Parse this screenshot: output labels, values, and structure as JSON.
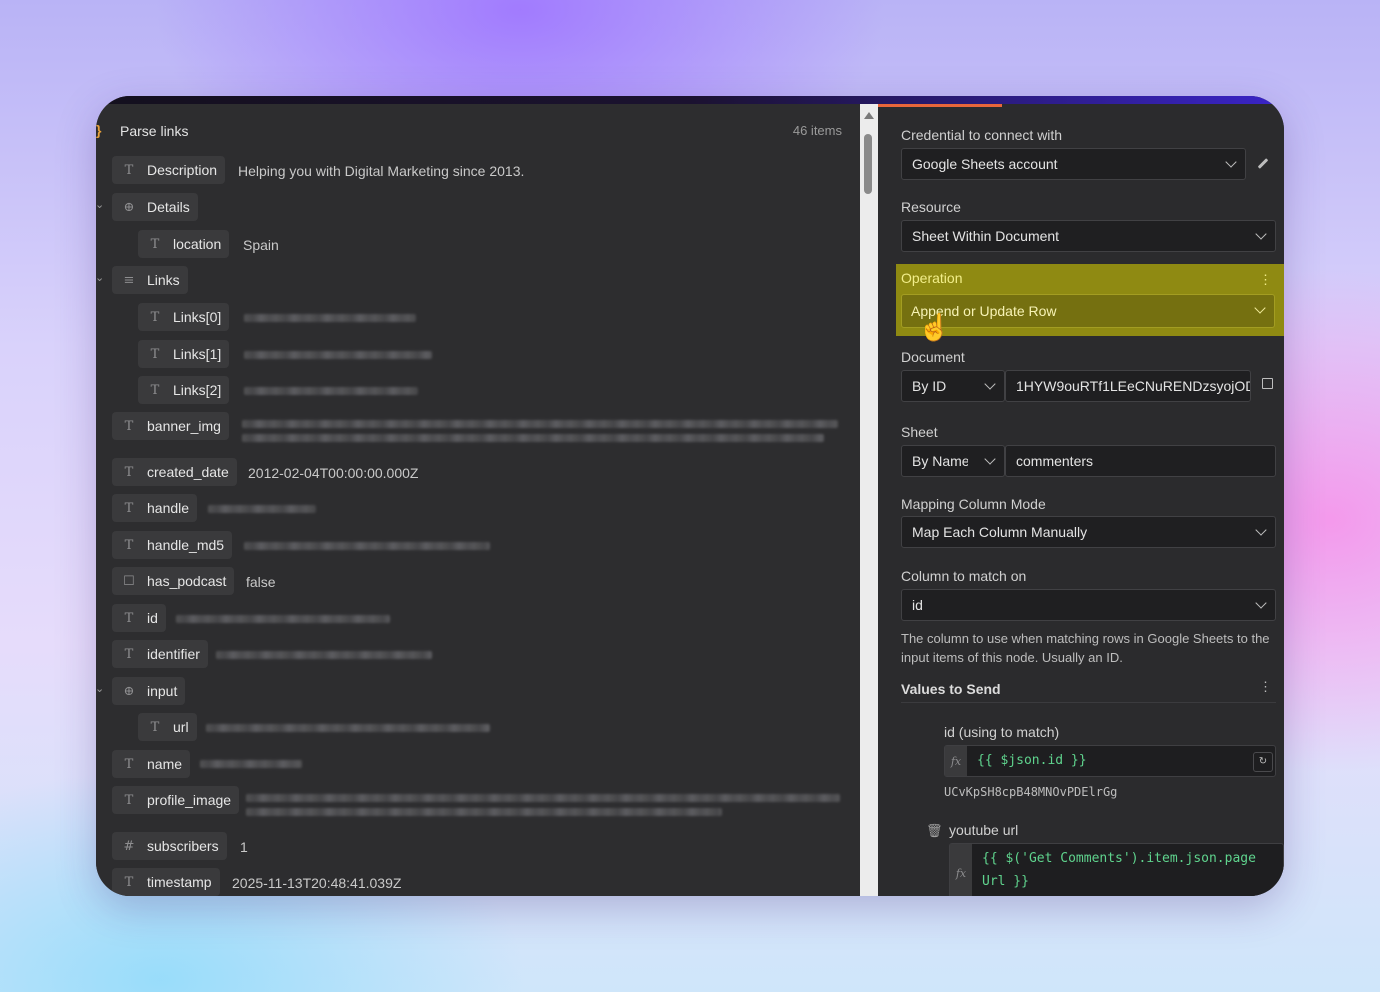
{
  "left_panel": {
    "title": "Parse links",
    "item_count": "46 items",
    "rows": [
      {
        "label": "Description",
        "type": "T",
        "value": "Helping you with Digital Marketing since 2013."
      },
      {
        "label": "Details",
        "type": "⊕",
        "value": ""
      },
      {
        "label": "location",
        "type": "T",
        "value": "Spain"
      },
      {
        "label": "Links",
        "type": "≡",
        "value": ""
      },
      {
        "label": "Links[0]",
        "type": "T",
        "value": ""
      },
      {
        "label": "Links[1]",
        "type": "T",
        "value": ""
      },
      {
        "label": "Links[2]",
        "type": "T",
        "value": ""
      },
      {
        "label": "banner_img",
        "type": "T",
        "value": ""
      },
      {
        "label": "created_date",
        "type": "T",
        "value": "2012-02-04T00:00:00.000Z"
      },
      {
        "label": "handle",
        "type": "T",
        "value": ""
      },
      {
        "label": "handle_md5",
        "type": "T",
        "value": ""
      },
      {
        "label": "has_podcast",
        "type": "☐",
        "value": "false"
      },
      {
        "label": "id",
        "type": "T",
        "value": ""
      },
      {
        "label": "identifier",
        "type": "T",
        "value": ""
      },
      {
        "label": "input",
        "type": "⊕",
        "value": ""
      },
      {
        "label": "url",
        "type": "T",
        "value": ""
      },
      {
        "label": "name",
        "type": "T",
        "value": ""
      },
      {
        "label": "profile_image",
        "type": "T",
        "value": ""
      },
      {
        "label": "subscribers",
        "type": "#",
        "value": "1"
      },
      {
        "label": "timestamp",
        "type": "T",
        "value": "2025-11-13T20:48:41.039Z"
      }
    ]
  },
  "right_panel": {
    "credential_label": "Credential to connect with",
    "credential_value": "Google Sheets account",
    "resource_label": "Resource",
    "resource_value": "Sheet Within Document",
    "operation_label": "Operation",
    "operation_value": "Append or Update Row",
    "document_label": "Document",
    "document_mode": "By ID",
    "document_id": "1HYW9ouRTf1LEeCNuRENDzsyojOD",
    "sheet_label": "Sheet",
    "sheet_mode": "By Name",
    "sheet_value": "commenters",
    "mapping_label": "Mapping Column Mode",
    "mapping_value": "Map Each Column Manually",
    "match_label": "Column to match on",
    "match_value": "id",
    "match_hint": "The column to use when matching rows in Google Sheets to the input items of this node. Usually an ID.",
    "values_label": "Values to Send",
    "field1_label": "id (using to match)",
    "field1_expr": "{{ $json.id }}",
    "field1_result": "UCvKpSH8cpB48MNOvPDElrGg",
    "field2_label": "youtube url",
    "field2_expr_line1": "{{ $('Get Comments').item.json.page",
    "field2_expr_line2": "Url }}"
  },
  "colors": {
    "accent_orange": "#e8663a",
    "highlight": "#8f8a12",
    "expression_green": "#5fd38d"
  }
}
